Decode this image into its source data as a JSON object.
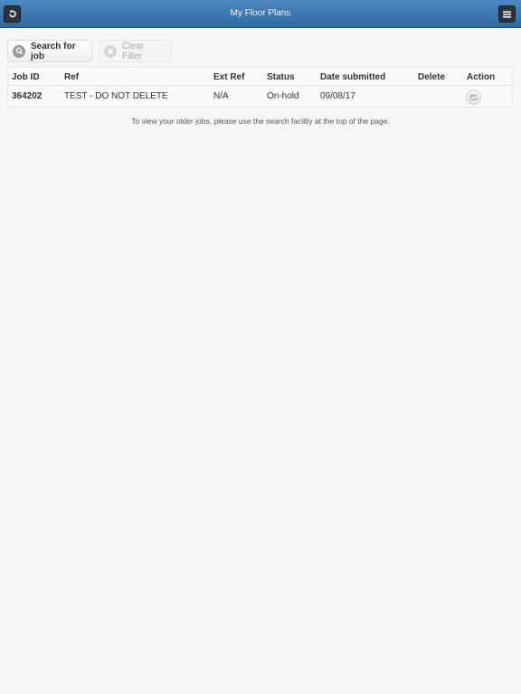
{
  "header": {
    "title": "My Floor Plans",
    "back_icon": "back-arrow-icon",
    "menu_icon": "menu-icon"
  },
  "toolbar": {
    "search_label": "Search for job",
    "search_icon": "search-icon",
    "clear_label": "Clear Filter",
    "clear_icon": "clear-icon"
  },
  "table": {
    "columns": [
      "Job ID",
      "Ref",
      "Ext Ref",
      "Status",
      "Date submitted",
      "Delete",
      "Action"
    ],
    "rows": [
      {
        "job_id": "364202",
        "ref": "TEST - DO NOT DELETE",
        "ext_ref": "N/A",
        "status": "On-hold",
        "date_submitted": "09/08/17",
        "delete": "",
        "action_icon": "view-plan-icon"
      }
    ]
  },
  "info_text": "To view your older jobs, please use the search facility at the top of the page.",
  "colors": {
    "header_bg": "#3a77b3",
    "link": "#2b6fb0",
    "page_bg": "#f6f6f6"
  }
}
